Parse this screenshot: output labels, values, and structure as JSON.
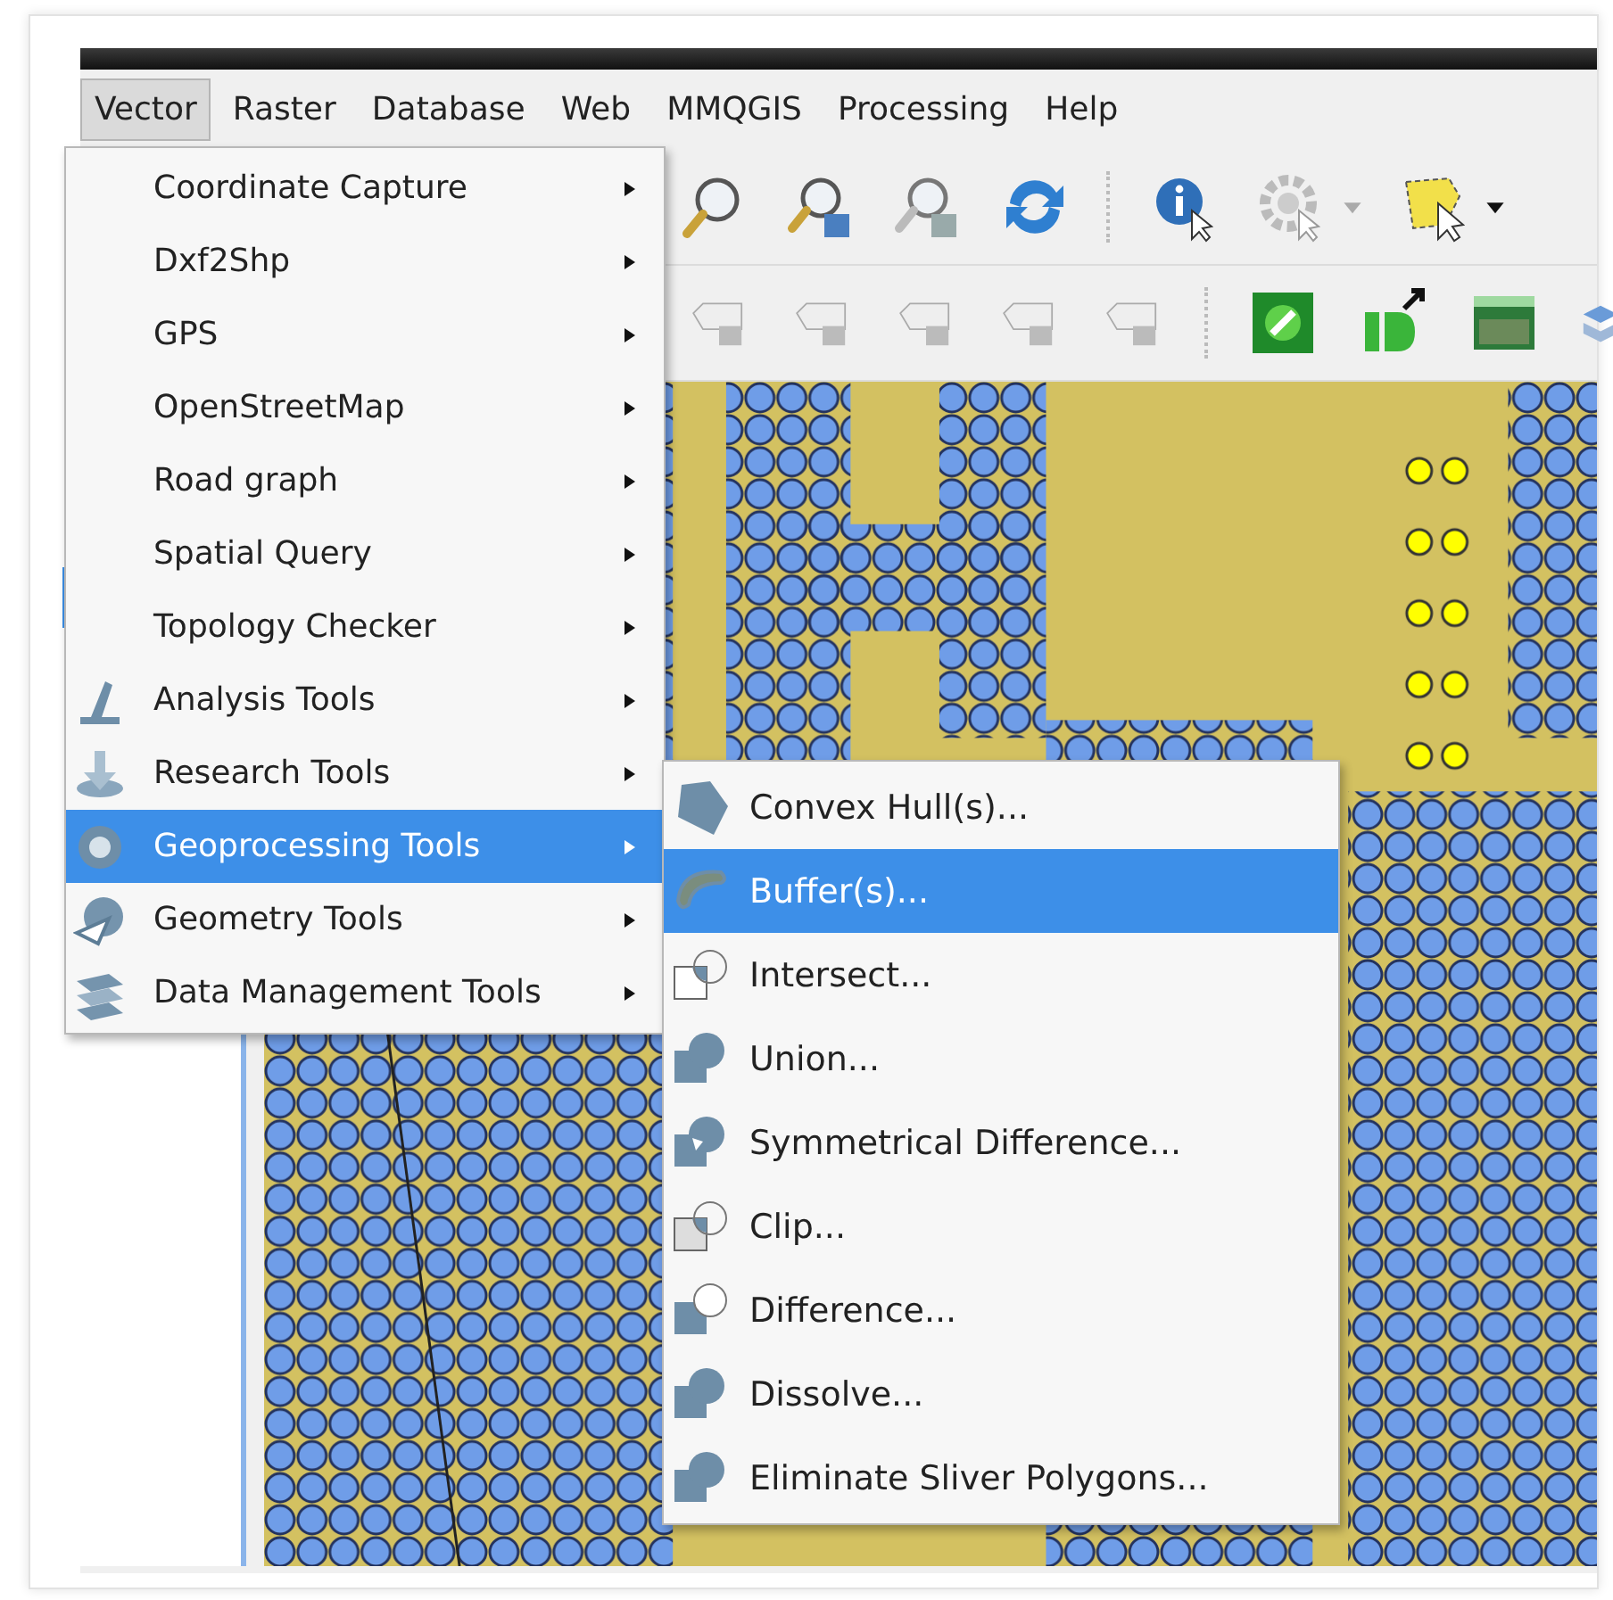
{
  "menubar": [
    {
      "label": "Vector",
      "selected": true
    },
    {
      "label": "Raster",
      "selected": false
    },
    {
      "label": "Database",
      "selected": false
    },
    {
      "label": "Web",
      "selected": false
    },
    {
      "label": "MMQGIS",
      "selected": false
    },
    {
      "label": "Processing",
      "selected": false
    },
    {
      "label": "Help",
      "selected": false
    }
  ],
  "vector_menu": {
    "items": [
      {
        "label": "Coordinate Capture",
        "selected": false,
        "has_submenu": true
      },
      {
        "label": "Dxf2Shp",
        "selected": false,
        "has_submenu": true
      },
      {
        "label": "GPS",
        "selected": false,
        "has_submenu": true
      },
      {
        "label": "OpenStreetMap",
        "selected": false,
        "has_submenu": true
      },
      {
        "label": "Road graph",
        "selected": false,
        "has_submenu": true
      },
      {
        "label": "Spatial Query",
        "selected": false,
        "has_submenu": true
      },
      {
        "label": "Topology Checker",
        "selected": false,
        "has_submenu": true
      },
      {
        "label": "Analysis Tools",
        "selected": false,
        "has_submenu": true
      },
      {
        "label": "Research Tools",
        "selected": false,
        "has_submenu": true
      },
      {
        "label": "Geoprocessing Tools",
        "selected": true,
        "has_submenu": true
      },
      {
        "label": "Geometry Tools",
        "selected": false,
        "has_submenu": true
      },
      {
        "label": "Data Management Tools",
        "selected": false,
        "has_submenu": true
      }
    ]
  },
  "geoprocessing_submenu": {
    "items": [
      {
        "label": "Convex Hull(s)...",
        "selected": false
      },
      {
        "label": "Buffer(s)...",
        "selected": true
      },
      {
        "label": "Intersect...",
        "selected": false
      },
      {
        "label": "Union...",
        "selected": false
      },
      {
        "label": "Symmetrical Difference...",
        "selected": false
      },
      {
        "label": "Clip...",
        "selected": false
      },
      {
        "label": "Difference...",
        "selected": false
      },
      {
        "label": "Dissolve...",
        "selected": false
      },
      {
        "label": "Eliminate Sliver Polygons...",
        "selected": false
      }
    ]
  }
}
